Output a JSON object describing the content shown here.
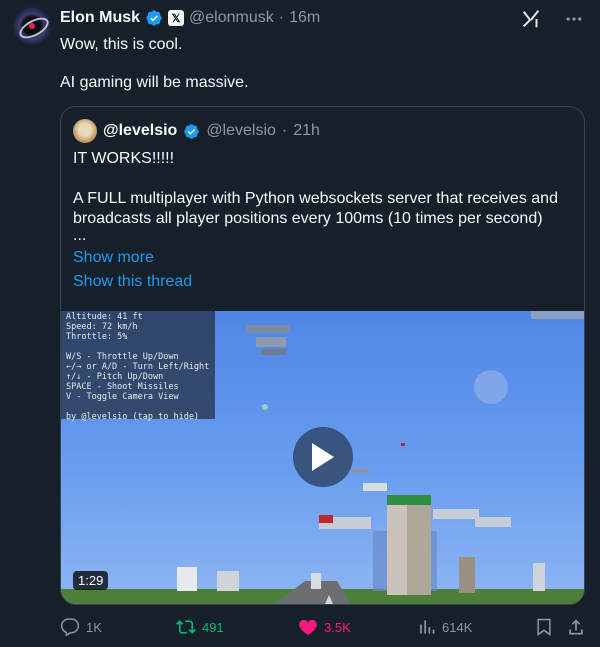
{
  "author": {
    "display_name": "Elon Musk",
    "handle": "@elonmusk",
    "separator": "·",
    "time": "16m",
    "x_badge": "𝕏"
  },
  "post": {
    "line1": "Wow, this is cool.",
    "line2": "AI gaming will be massive."
  },
  "quoted": {
    "display_name": "@levelsio",
    "handle": "@levelsio",
    "separator": "·",
    "time": "21h",
    "line1": "IT WORKS!!!!!",
    "line2": "A FULL multiplayer with Python websockets server that receives and",
    "line3": "broadcasts all player positions every 100ms (10 times per second)",
    "line4": "...",
    "show_more": "Show more",
    "show_thread": "Show this thread",
    "video": {
      "duration": "1:29",
      "hud": [
        "Altitude: 41 ft",
        "Speed: 72 km/h",
        "Throttle: 5%",
        "",
        "W/S - Throttle Up/Down",
        "←/→ or A/D - Turn Left/Right",
        "↑/↓ - Pitch Up/Down",
        "SPACE - Shoot Missiles",
        "V - Toggle Camera View",
        "",
        "by @levelsio (tap to hide)"
      ]
    }
  },
  "metrics": {
    "replies": "1K",
    "reposts": "491",
    "likes": "3.5K",
    "views": "614K"
  },
  "colors": {
    "background": "#15202b",
    "link": "#1d9bf0",
    "repost": "#00ba7c",
    "like": "#f91880",
    "muted": "#8b98a5"
  },
  "icons": {
    "verified": "verified-badge-icon",
    "grok": "grok-icon",
    "more": "more-icon",
    "play": "play-icon",
    "reply": "reply-icon",
    "repost": "repost-icon",
    "like": "heart-icon",
    "views": "views-icon",
    "bookmark": "bookmark-icon",
    "share": "share-icon"
  }
}
